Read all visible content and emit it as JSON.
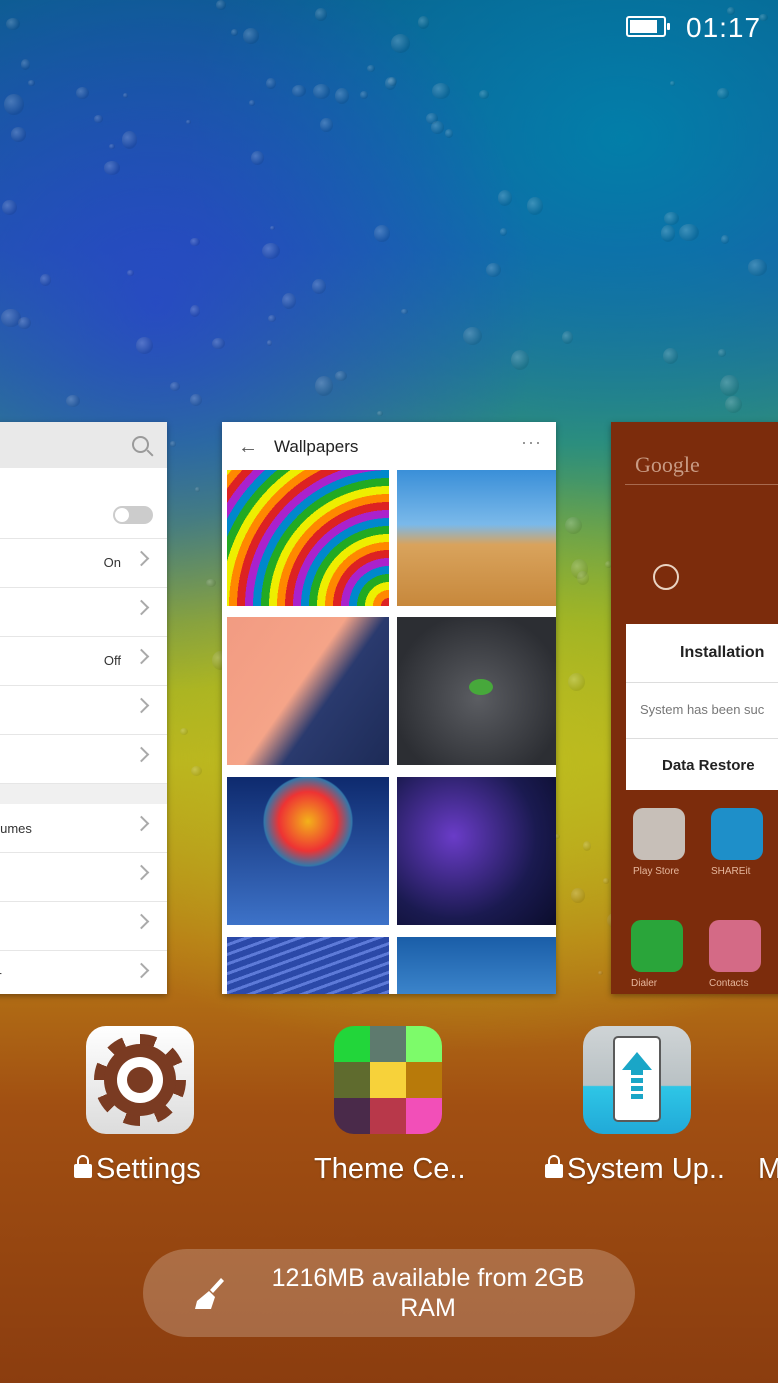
{
  "status_bar": {
    "time": "01:17",
    "battery_level": 0.85
  },
  "recent_cards": {
    "left_card": {
      "rows": [
        {
          "label": "",
          "value": "",
          "control": "toggle"
        },
        {
          "label": "",
          "value": "On",
          "control": "chevron"
        },
        {
          "label": "",
          "value": "",
          "control": "chevron"
        },
        {
          "label": "",
          "value": "Off",
          "control": "chevron"
        },
        {
          "label": "",
          "value": "",
          "control": "chevron"
        },
        {
          "label": "",
          "value": "",
          "control": "chevron"
        },
        {
          "label": "olumes",
          "value": "",
          "control": "chevron"
        },
        {
          "label": "",
          "value": "",
          "control": "chevron"
        },
        {
          "label": "",
          "value": "",
          "control": "chevron"
        },
        {
          "label": "er",
          "value": "",
          "control": "chevron"
        }
      ]
    },
    "middle_card": {
      "title": "Wallpapers",
      "menu": "···"
    },
    "right_card": {
      "search_hint": "Google",
      "dialog": {
        "title": "Installation",
        "message": "System has been suc",
        "button": "Data Restore"
      },
      "apps": [
        {
          "label": "Play Store",
          "color": "#c7bfb8"
        },
        {
          "label": "SHAREit",
          "color": "#1e8fc9"
        },
        {
          "label": "Dialer",
          "color": "#2aa53a"
        },
        {
          "label": "Contacts",
          "color": "#d46a86"
        }
      ]
    }
  },
  "apps": [
    {
      "label": "Settings",
      "locked": true,
      "icon": "gear-icon"
    },
    {
      "label": "Theme Ce..",
      "locked": false,
      "icon": "theme-grid-icon"
    },
    {
      "label": "System Up..",
      "locked": true,
      "icon": "system-update-icon"
    },
    {
      "label": "M",
      "locked": false
    }
  ],
  "theme_colors": [
    "#22d63a",
    "#5e7a6e",
    "#7dfb6a",
    "#5f6b2e",
    "#f7d23a",
    "#b87a0a",
    "#4a2a4a",
    "#b8384a",
    "#f24fb8"
  ],
  "memory": {
    "text": "1216MB   available from 2GB RAM"
  }
}
